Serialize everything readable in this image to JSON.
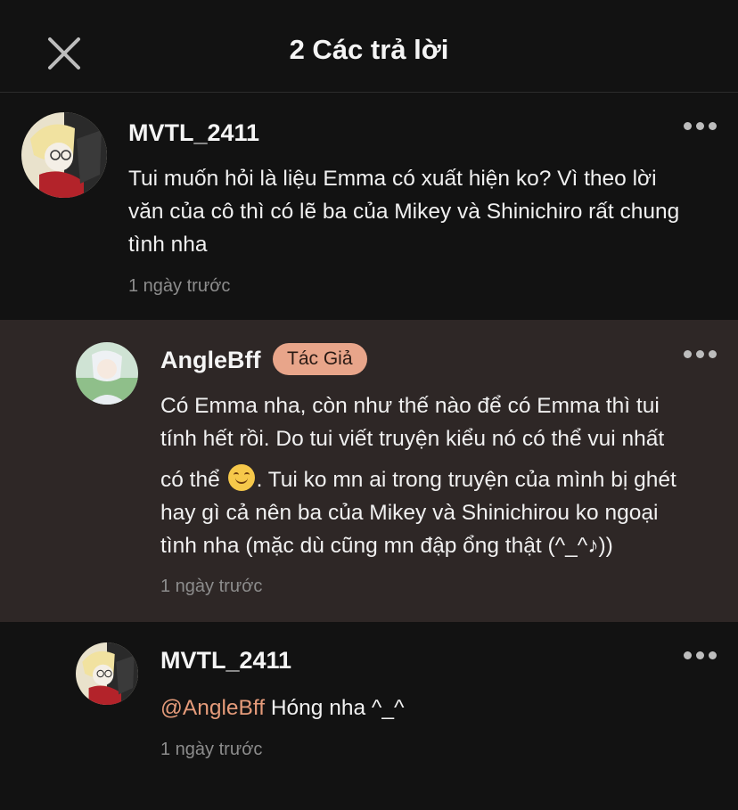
{
  "header": {
    "title": "2 Các trả lời",
    "close_icon": "close-icon"
  },
  "comments": [
    {
      "username": "MVTL_2411",
      "lines": [
        "Tui muốn hỏi là liệu Emma có xuất hiện ko? Vì theo lời",
        "văn của cô thì có lẽ ba của Mikey và Shinichiro rất chung",
        "tình nha"
      ],
      "timestamp": "1 ngày trước",
      "more_icon": "more-options-icon"
    },
    {
      "username": "AngleBff",
      "badge": "Tác Giả",
      "lines": [
        "Có Emma nha, còn như thế nào để có Emma thì tui",
        "tính hết rồi. Do tui viết truyện kiểu nó có thể vui nhất",
        "có thể",
        ". Tui ko mn ai trong truyện của mình bị ghét",
        "hay gì cả nên ba của Mikey và Shinichirou ko ngoại",
        "tình nha (mặc dù cũng mn đập ổng thật (^_^♪))"
      ],
      "emoji_icon": "smiling-face-emoji-icon",
      "timestamp": "1 ngày trước",
      "more_icon": "more-options-icon",
      "highlight_color": "#2e2726",
      "badge_color": "#e8a58a"
    },
    {
      "username": "MVTL_2411",
      "mention": "@AngleBff",
      "text": " Hóng nha ^_^",
      "timestamp": "1 ngày trước",
      "more_icon": "more-options-icon",
      "mention_color": "#e59b7a"
    }
  ]
}
